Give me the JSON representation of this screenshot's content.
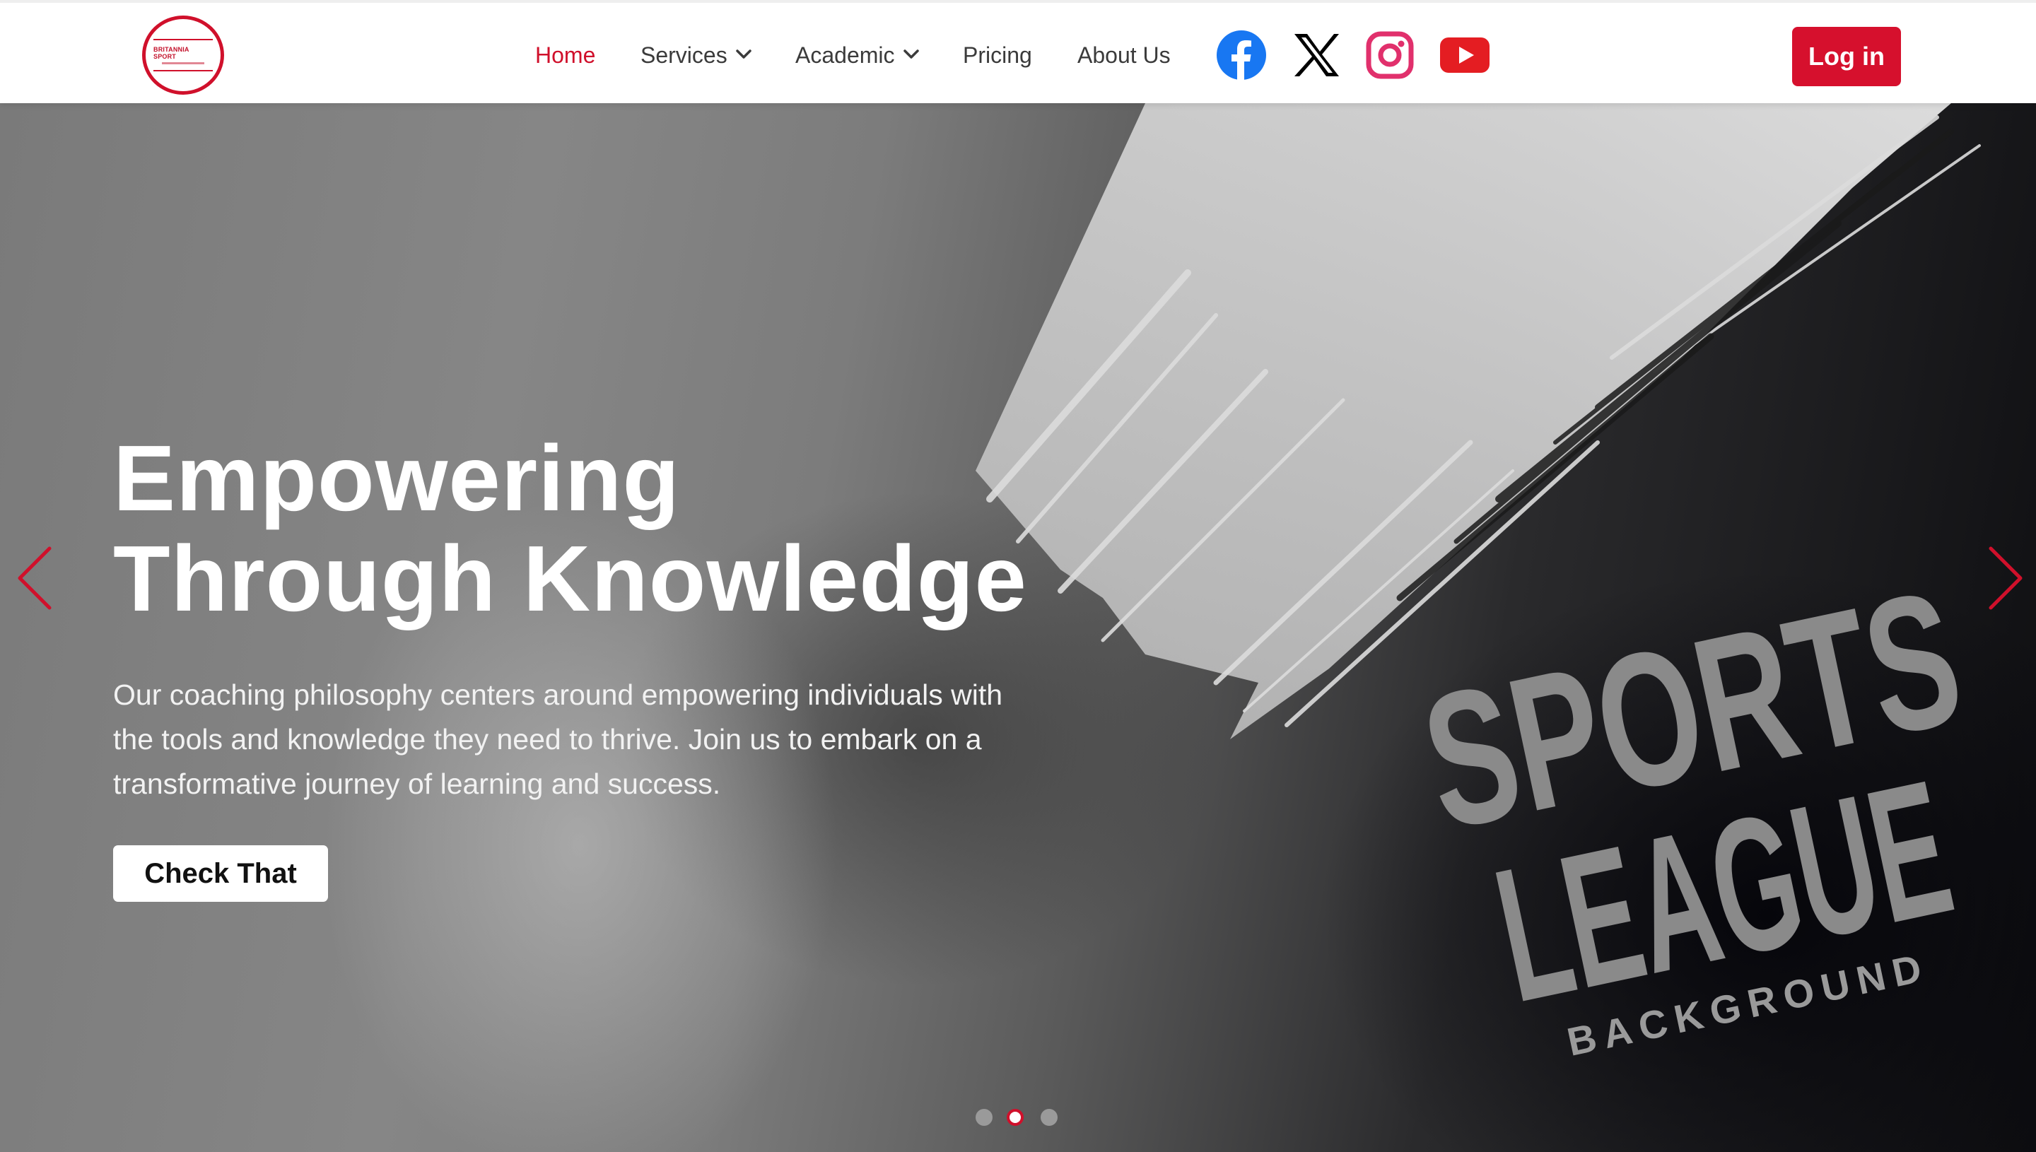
{
  "brand": {
    "logo_text": "BRITANNIA SPORT",
    "accent_color": "#d0102b"
  },
  "nav": {
    "items": [
      {
        "label": "Home",
        "active": true
      },
      {
        "label": "Services",
        "has_dropdown": true
      },
      {
        "label": "Academic",
        "has_dropdown": true
      },
      {
        "label": "Pricing"
      },
      {
        "label": "About Us"
      }
    ],
    "social": [
      "facebook-icon",
      "x-icon",
      "instagram-icon",
      "youtube-icon"
    ],
    "login_label": "Log in"
  },
  "hero": {
    "title_line1": "Empowering",
    "title_line2": "Through Knowledge",
    "description": "Our coaching philosophy centers around empowering individuals with the tools and knowledge they need to thrive. Join us to embark on a transformative journey of learning and success.",
    "cta_label": "Check That",
    "art": {
      "line1": "SPORTS",
      "line2": "LEAGUE",
      "line3": "BACKGROUND"
    },
    "carousel": {
      "slide_count": 3,
      "active_index": 1
    }
  }
}
